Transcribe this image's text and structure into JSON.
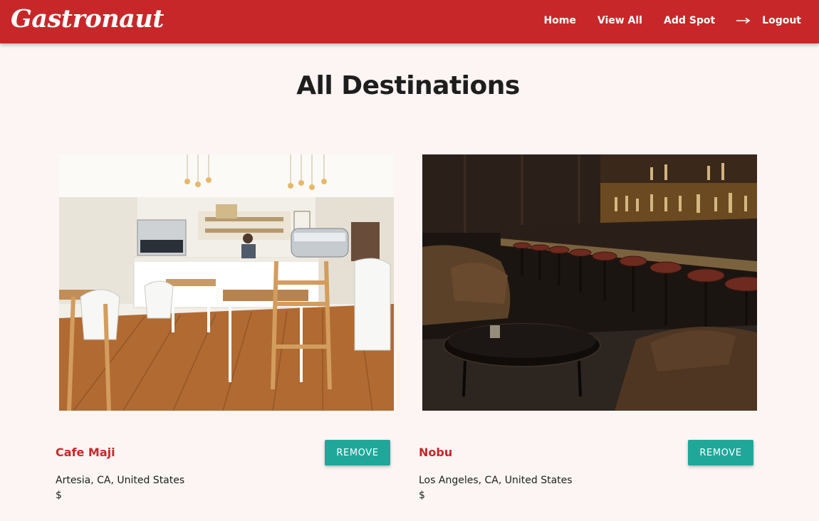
{
  "header": {
    "logo": "Gastronaut",
    "nav": {
      "home": "Home",
      "view_all": "View All",
      "add_spot": "Add Spot",
      "logout": "Logout"
    },
    "color": "#c8272a"
  },
  "page": {
    "title": "All Destinations"
  },
  "destinations": [
    {
      "name": "Cafe Maji",
      "location": "Artesia, CA, United States",
      "price": "$",
      "remove_label": "REMOVE"
    },
    {
      "name": "Nobu",
      "location": "Los Angeles, CA, United States",
      "price": "$",
      "remove_label": "REMOVE"
    }
  ],
  "colors": {
    "accent": "#c8272a",
    "button": "#1fa89a",
    "background": "#fcf5f4"
  }
}
